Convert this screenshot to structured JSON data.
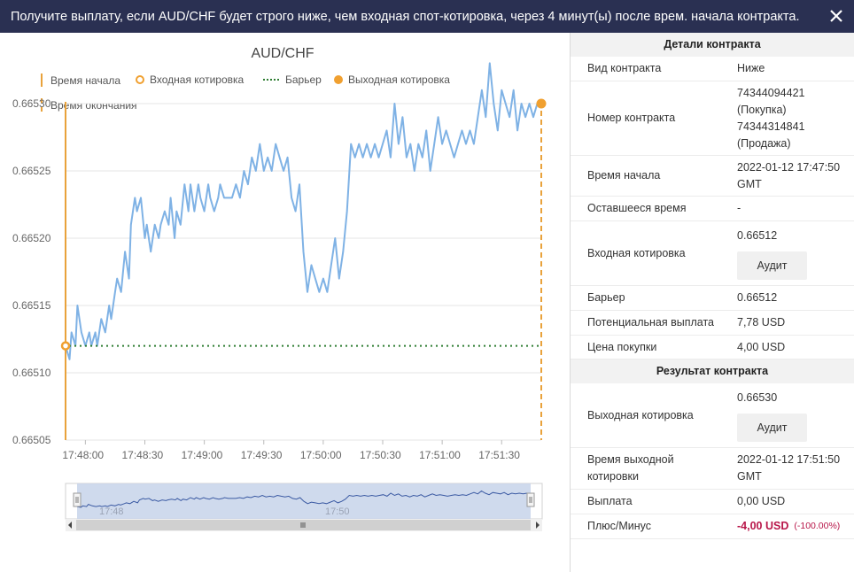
{
  "header": {
    "title": "Получите выплату, если AUD/CHF будет строго ниже, чем входная спот-котировка, через 4 минут(ы) после врем. начала контракта."
  },
  "chart": {
    "title": "AUD/CHF",
    "legend": {
      "start_time": "Время начала",
      "entry_spot": "Входная котировка",
      "barrier": "Барьер",
      "exit_spot": "Выходная котировка",
      "end_time": "Время окончания"
    },
    "navigator_labels": [
      "17:48",
      "17:50"
    ]
  },
  "chart_data": {
    "type": "line",
    "title": "AUD/CHF",
    "y_ticks": [
      "0.66505",
      "0.66510",
      "0.66515",
      "0.66520",
      "0.66525",
      "0.66530"
    ],
    "x_ticks": [
      "17:48:00",
      "17:48:30",
      "17:49:00",
      "17:49:30",
      "17:50:00",
      "17:50:30",
      "17:51:00",
      "17:51:30"
    ],
    "ylim": [
      0.66505,
      0.6653
    ],
    "xlim_seconds_after_17_47_50": [
      0,
      240
    ],
    "entry_spot": 0.66512,
    "barrier": 0.66512,
    "exit_spot": 0.6653,
    "series": [
      {
        "name": "AUD/CHF",
        "x_seconds": [
          0,
          2,
          3,
          5,
          6,
          8,
          10,
          12,
          13,
          15,
          16,
          18,
          20,
          22,
          23,
          25,
          26,
          28,
          30,
          32,
          33,
          35,
          36,
          38,
          40,
          41,
          43,
          45,
          47,
          48,
          50,
          52,
          53,
          55,
          56,
          58,
          60,
          62,
          63,
          65,
          67,
          68,
          70,
          72,
          73,
          75,
          77,
          78,
          80,
          82,
          84,
          86,
          88,
          90,
          92,
          94,
          96,
          98,
          100,
          102,
          104,
          106,
          108,
          110,
          112,
          114,
          116,
          118,
          120,
          122,
          124,
          126,
          128,
          130,
          132,
          134,
          136,
          138,
          140,
          142,
          144,
          146,
          148,
          150,
          152,
          154,
          156,
          158,
          160,
          162,
          164,
          166,
          168,
          170,
          172,
          174,
          176,
          178,
          180,
          182,
          184,
          186,
          188,
          190,
          192,
          194,
          196,
          198,
          200,
          202,
          204,
          206,
          208,
          210,
          212,
          214,
          216,
          218,
          220,
          222,
          224,
          226,
          228,
          230,
          232,
          234,
          236,
          238,
          240
        ],
        "values": [
          0.66512,
          0.66511,
          0.66513,
          0.66512,
          0.66515,
          0.66513,
          0.66512,
          0.66513,
          0.66512,
          0.66513,
          0.66512,
          0.66514,
          0.66513,
          0.66515,
          0.66514,
          0.66516,
          0.66517,
          0.66516,
          0.66519,
          0.66517,
          0.66521,
          0.66523,
          0.66522,
          0.66523,
          0.6652,
          0.66521,
          0.66519,
          0.66521,
          0.6652,
          0.66521,
          0.66522,
          0.66521,
          0.66523,
          0.6652,
          0.66522,
          0.66521,
          0.66524,
          0.66522,
          0.66524,
          0.66522,
          0.66524,
          0.66523,
          0.66522,
          0.66524,
          0.66523,
          0.66522,
          0.66523,
          0.66524,
          0.66523,
          0.66523,
          0.66523,
          0.66524,
          0.66523,
          0.66525,
          0.66524,
          0.66526,
          0.66525,
          0.66527,
          0.66525,
          0.66526,
          0.66525,
          0.66527,
          0.66526,
          0.66525,
          0.66526,
          0.66523,
          0.66522,
          0.66524,
          0.66519,
          0.66516,
          0.66518,
          0.66517,
          0.66516,
          0.66517,
          0.66516,
          0.66518,
          0.6652,
          0.66517,
          0.66519,
          0.66522,
          0.66527,
          0.66526,
          0.66527,
          0.66526,
          0.66527,
          0.66526,
          0.66527,
          0.66526,
          0.66527,
          0.66528,
          0.66526,
          0.6653,
          0.66527,
          0.66529,
          0.66526,
          0.66527,
          0.66525,
          0.66527,
          0.66526,
          0.66528,
          0.66525,
          0.66527,
          0.66529,
          0.66527,
          0.66528,
          0.66527,
          0.66526,
          0.66527,
          0.66528,
          0.66527,
          0.66528,
          0.66527,
          0.66529,
          0.66531,
          0.66529,
          0.66533,
          0.6653,
          0.66528,
          0.66531,
          0.6653,
          0.66529,
          0.66531,
          0.66528,
          0.6653,
          0.66529,
          0.6653,
          0.66529,
          0.6653,
          0.6653
        ]
      }
    ]
  },
  "details": {
    "header": "Детали контракта",
    "rows": {
      "type": {
        "label": "Вид контракта",
        "value": "Ниже"
      },
      "id": {
        "label": "Номер контракта",
        "value1": "74344094421",
        "value2": "(Покупка)",
        "value3": "74344314841",
        "value4": "(Продажа)"
      },
      "start": {
        "label": "Время начала",
        "value1": "2022-01-12 17:47:50",
        "value2": "GMT"
      },
      "remaining": {
        "label": "Оставшееся время",
        "value": "-"
      },
      "entry": {
        "label": "Входная котировка",
        "value": "0.66512",
        "button": "Аудит"
      },
      "barrier": {
        "label": "Барьер",
        "value": "0.66512"
      },
      "payout": {
        "label": "Потенциальная выплата",
        "value": "7,78 USD"
      },
      "price": {
        "label": "Цена покупки",
        "value": "4,00 USD"
      }
    }
  },
  "result": {
    "header": "Результат контракта",
    "rows": {
      "exit": {
        "label": "Выходная котировка",
        "value": "0.66530",
        "button": "Аудит"
      },
      "exit_time": {
        "label1": "Время выходной",
        "label2": "котировки",
        "value1": "2022-01-12 17:51:50",
        "value2": "GMT"
      },
      "payout": {
        "label": "Выплата",
        "value": "0,00 USD"
      },
      "profit": {
        "label": "Плюс/Минус",
        "value": "-4,00 USD",
        "pct": "(-100.00%)"
      }
    }
  },
  "colors": {
    "header_bg": "#2a3052",
    "series": "#7fb2e5",
    "marker": "#f0a030",
    "barrier": "#2e7d32",
    "loss": "#b8174a"
  }
}
